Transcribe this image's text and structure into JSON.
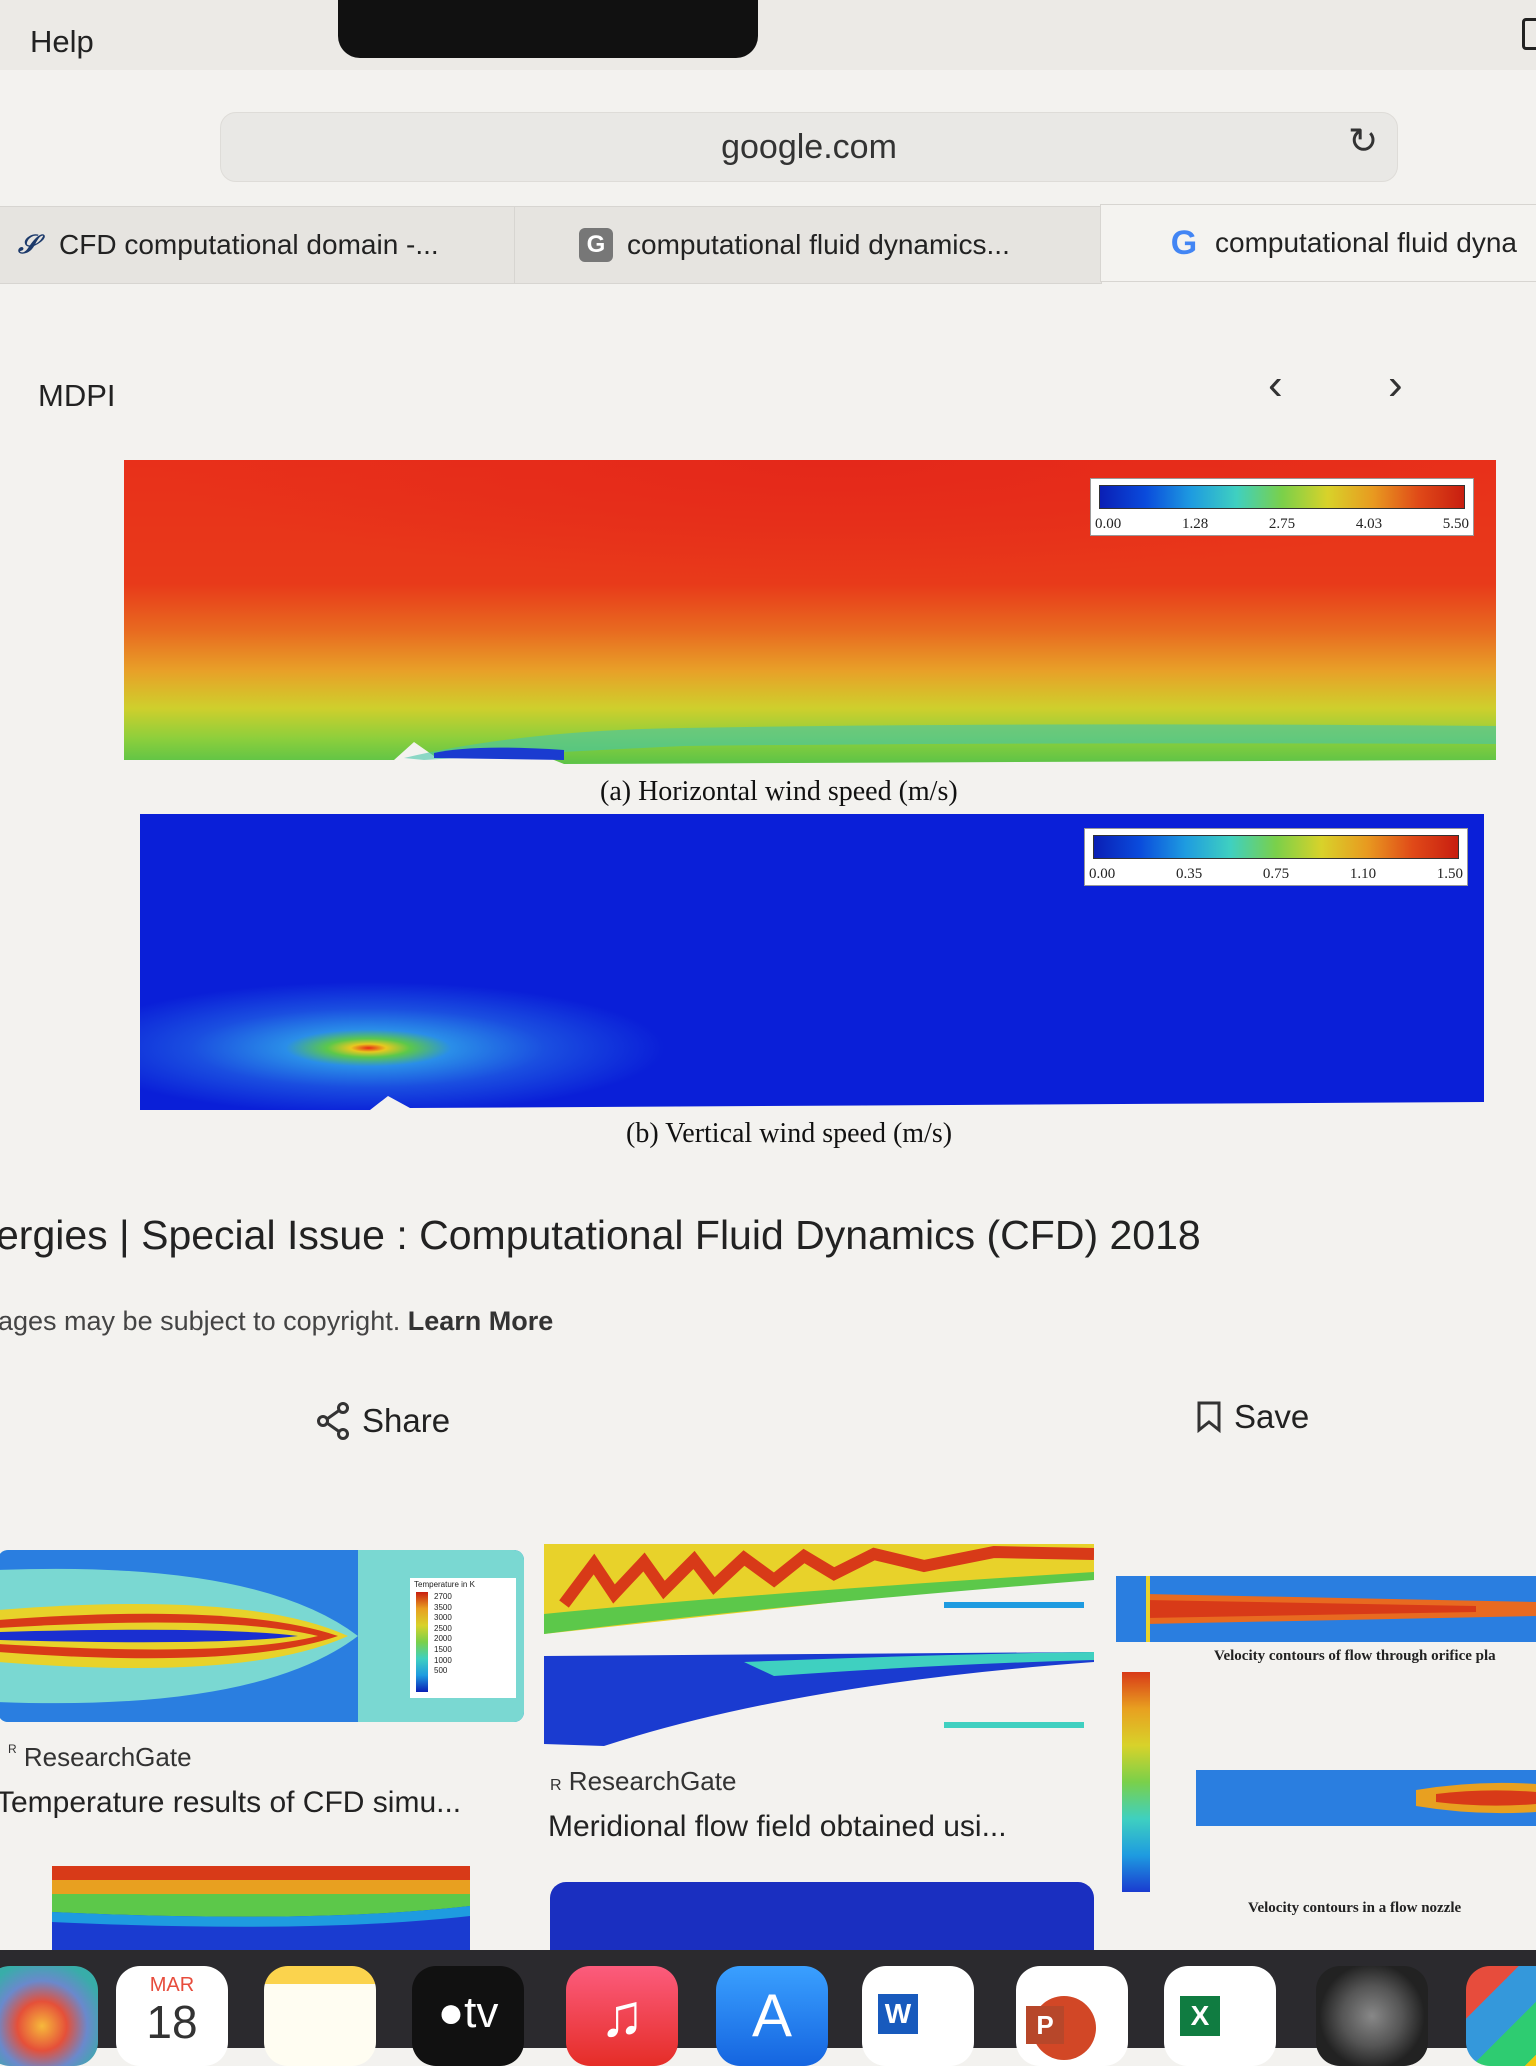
{
  "menubar": {
    "help": "Help"
  },
  "address_bar": {
    "url": "google.com"
  },
  "tabs": [
    {
      "label": "CFD computational domain -...",
      "icon": "mdpi-icon"
    },
    {
      "label": "computational fluid dynamics...",
      "icon": "google-g-icon"
    },
    {
      "label": "computational fluid dyna",
      "icon": "google-g-icon"
    }
  ],
  "viewer": {
    "source": "MDPI",
    "figure": {
      "panel_a": {
        "caption": "(a) Horizontal wind speed (m/s)",
        "scale": [
          "0.00",
          "1.28",
          "2.75",
          "4.03",
          "5.50"
        ]
      },
      "panel_b": {
        "caption": "(b) Vertical wind speed (m/s)",
        "scale": [
          "0.00",
          "0.35",
          "0.75",
          "1.10",
          "1.50"
        ]
      }
    },
    "title": "ergies | Special Issue : Computational Fluid Dynamics (CFD) 2018",
    "copyright": "ages may be subject to copyright.",
    "learn_more": "Learn More",
    "share_label": "Share",
    "save_label": "Save"
  },
  "related": [
    {
      "source": "ResearchGate",
      "title": "Temperature results of CFD simu...",
      "legend_title": "Temperature in K",
      "legend_values": [
        "2700",
        "3500",
        "3000",
        "2500",
        "2000",
        "1500",
        "1000",
        "500"
      ]
    },
    {
      "source": "ResearchGate",
      "title": "Meridional flow field obtained usi..."
    },
    {
      "label_top": "Velocity contours of flow through orifice pla",
      "label_bottom": "Velocity contours in a flow nozzle"
    }
  ],
  "dock": {
    "calendar_month": "MAR",
    "calendar_day": "18",
    "tv_label": "tv",
    "word": "W",
    "powerpoint": "P",
    "excel": "X"
  }
}
